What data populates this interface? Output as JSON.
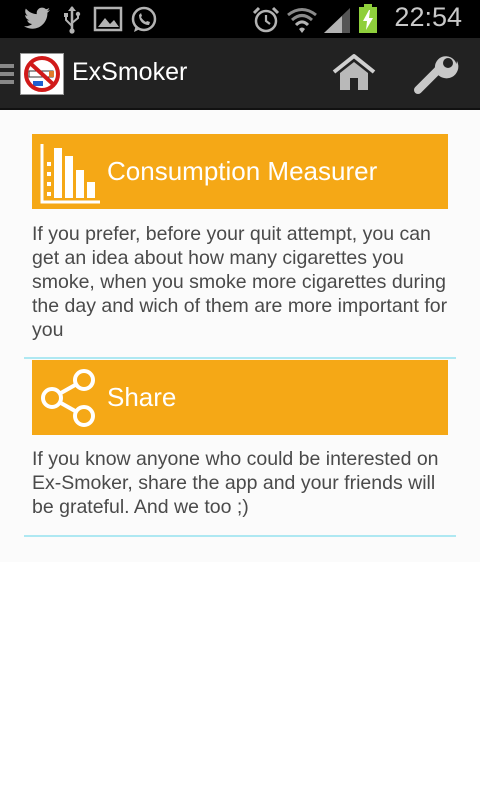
{
  "status_bar": {
    "time": "22:54",
    "left_icons": [
      "twitter-icon",
      "usb-icon",
      "image-icon",
      "whatsapp-icon"
    ],
    "right_icons": [
      "alarm-icon",
      "wifi-icon",
      "signal-icon",
      "battery-charging-icon"
    ]
  },
  "action_bar": {
    "title": "ExSmoker",
    "home_icon": "home-icon",
    "settings_icon": "wrench-icon"
  },
  "cards": [
    {
      "title": "Consumption Measurer",
      "icon": "bar-chart-icon",
      "description": "If you prefer, before your quit attempt, you can get an idea about how many cigarettes you smoke, when you smoke more cigarettes during the day and wich of them are more important for you"
    },
    {
      "title": "Share",
      "icon": "share-icon",
      "description": "If you know anyone who could be interested on Ex-Smoker, share the app and your friends will be grateful. And we too ;)"
    }
  ],
  "colors": {
    "accent": "#f5a816",
    "divider": "#aee8f2",
    "action_bar": "#222222"
  }
}
